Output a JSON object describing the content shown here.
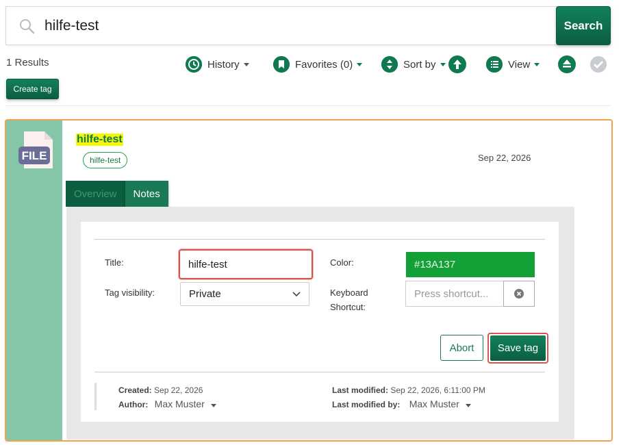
{
  "search": {
    "value": "hilfe-test",
    "button_label": "Search"
  },
  "toolbar": {
    "results_count": "1 Results",
    "history_label": "History",
    "favorites_label": "Favorites (0)",
    "sort_label": "Sort by",
    "view_label": "View",
    "create_tag_label": "Create tag"
  },
  "result": {
    "title": "hilfe-test",
    "tag": "hilfe-test",
    "date": "Sep 22, 2026",
    "file_label": "FILE",
    "tabs": [
      {
        "label": "Overview",
        "active": false
      },
      {
        "label": "Notes",
        "active": true
      }
    ]
  },
  "form": {
    "title_label": "Title:",
    "title_value": "hilfe-test",
    "color_label": "Color:",
    "color_value": "#13A137",
    "visibility_label": "Tag visibility:",
    "visibility_value": "Private",
    "shortcut_label_1": "Keyboard",
    "shortcut_label_2": "Shortcut:",
    "shortcut_placeholder": "Press shortcut...",
    "abort_label": "Abort",
    "save_label": "Save tag"
  },
  "meta": {
    "created_label": "Created:",
    "created_value": "Sep 22, 2026",
    "author_label": "Author:",
    "author_value": "Max Muster",
    "modified_label": "Last modified:",
    "modified_value": "Sep 22, 2026, 6:11:00 PM",
    "modified_by_label": "Last modified by:",
    "modified_by_value": "Max Muster"
  },
  "colors": {
    "brand": "#0f7a4f",
    "highlight": "#f4f70a",
    "card_border": "#f0a24a",
    "sidebar": "#85c6a9",
    "tag_color": "#13a137"
  }
}
